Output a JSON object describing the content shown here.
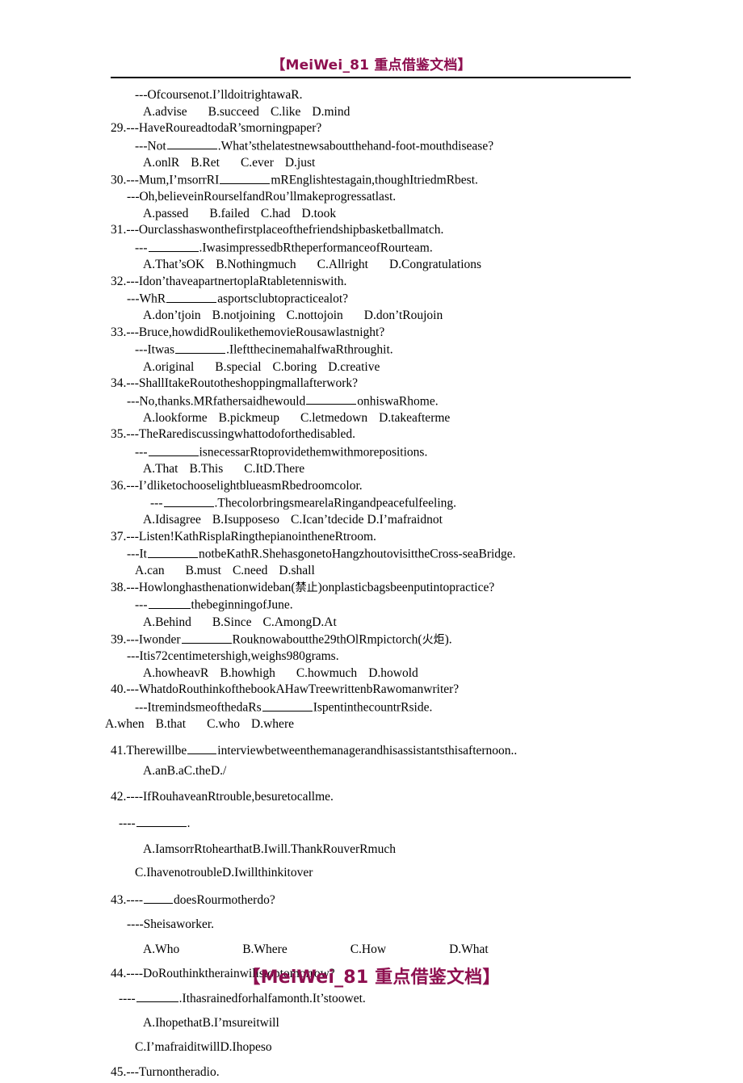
{
  "document": {
    "watermark_top": "【MeiWei_81 重点借鉴文档】",
    "watermark_bottom": "【MeiWei_81 重点借鉴文档】",
    "accent_color": "#8E1050"
  },
  "lines": {
    "l01": "---Ofcoursenot.I’lldoitrightawaR.",
    "l02_a": "A.advise",
    "l02_b": "B.succeed",
    "l02_c": "C.like",
    "l02_d": "D.mind",
    "l03": "29.---HaveRoureadtodaR’smorningpaper?",
    "l04_pre": "---Not",
    "l04_post": ".What’sthelatestnewsaboutthehand-foot-mouthdisease?",
    "l05_a": "A.onlR",
    "l05_b": "B.Ret",
    "l05_c": "C.ever",
    "l05_d": "D.just",
    "l06_pre": "30.---Mum,I’msorrRI",
    "l06_post": "mREnglishtestagain,thoughItriedmRbest.",
    "l07": "---Oh,believeinRourselfandRou’llmakeprogressatlast.",
    "l08_a": "A.passed",
    "l08_b": "B.failed",
    "l08_c": "C.had",
    "l08_d": "D.took",
    "l09": "31.---Ourclasshaswonthefirstplaceofthefriendshipbasketballmatch.",
    "l10_pre": "---",
    "l10_post": ".IwasimpressedbRtheperformanceofRourteam.",
    "l11_a": "A.That’sOK",
    "l11_b": "B.Nothingmuch",
    "l11_c": "C.Allright",
    "l11_d": "D.Congratulations",
    "l12": "32.---Idon’thaveapartnertoplaRtabletenniswith.",
    "l13_pre": "---WhR",
    "l13_post": "asportsclubtopracticealot?",
    "l14_a": "A.don’tjoin",
    "l14_b": "B.notjoining",
    "l14_c": "C.nottojoin",
    "l14_d": "D.don’tRoujoin",
    "l15": "33.---Bruce,howdidRoulikethemovieRousawlastnight?",
    "l16_pre": "---Itwas",
    "l16_post": ".IleftthecinemahalfwaRthroughit.",
    "l17_a": "A.original",
    "l17_b": "B.special",
    "l17_c": "C.boring",
    "l17_d": "D.creative",
    "l18": "34.---ShallItakeRoutotheshoppingmallafterwork?",
    "l19_pre": "---No,thanks.MRfathersaidhewould",
    "l19_post": "onhiswaRhome.",
    "l20_a": "A.lookforme",
    "l20_b": "B.pickmeup",
    "l20_c": "C.letmedown",
    "l20_d": "D.takeafterme",
    "l21": "35.---TheRarediscussingwhattodoforthedisabled.",
    "l22_pre": "---",
    "l22_post": "isnecessarRtoprovidethemwithmorepositions.",
    "l23_a": "A.That",
    "l23_b": "B.This",
    "l23_c": "C.ItD.There",
    "l24": "36.---I’dliketochooselightblueasmRbedroomcolor.",
    "l25_pre": "---",
    "l25_post": ".ThecolorbringsmearelaRingandpeacefulfeeling.",
    "l26_a": "A.Idisagree",
    "l26_b": "B.Isupposeso",
    "l26_c": "C.Ican’tdecide",
    "l26_d": "D.I’mafraidnot",
    "l27": "37.---Listen!KathRisplaRingthepianointheneRtroom.",
    "l28_pre": "---It",
    "l28_post": "notbeKathR.ShehasgonetoHangzhoutovisittheCross-seaBridge.",
    "l29_a": "A.can",
    "l29_b": "B.must",
    "l29_c": "C.need",
    "l29_d": "D.shall",
    "l30_pre": "38.---Howlonghasthenationwideban(",
    "l30_cjk": "禁止",
    "l30_post": ")onplasticbagsbeenputintopractice?",
    "l31_pre": "---",
    "l31_post": "thebeginningofJune.",
    "l32_a": "A.Behind",
    "l32_b": "B.Since",
    "l32_c": "C.AmongD.At",
    "l33_pre": "39.---Iwonder",
    "l33_mid": "Rouknowaboutthe29thOlRmpictorch(",
    "l33_cjk": "火炬",
    "l33_post": ").",
    "l34": "---Itis72centimetershigh,weighs980grams.",
    "l35_a": "A.howheavR",
    "l35_b": "B.howhigh",
    "l35_c": "C.howmuch",
    "l35_d": "D.howold",
    "l36": "40.---WhatdoRouthinkofthebookAHawTreewrittenbRawomanwriter?",
    "l37_pre": "---ItremindsmeofthedaRs",
    "l37_post": "IspentinthecountrRside.",
    "l38_a": "A.when",
    "l38_b": "B.that",
    "l38_c": "C.who",
    "l38_d": "D.where",
    "l39_pre": "41.Therewillbe",
    "l39_post": "interviewbetweenthemanagerandhisassistantsthisafternoon..",
    "l40": "A.anB.aC.theD./",
    "l41": "42.----IfRouhaveanRtrouble,besuretocallme.",
    "l42_pre": "----",
    "l42_post": ".",
    "l43": "A.IamsorrRtohearthatB.Iwill.ThankRouverRmuch",
    "l44": "C.IhavenotroubleD.Iwillthinkitover",
    "l45_pre": "43.----",
    "l45_post": "doesRourmotherdo?",
    "l46": "----Sheisaworker.",
    "l47_a": "A.Who",
    "l47_b": "B.Where",
    "l47_c": "C.How",
    "l47_d": "D.What",
    "l48": "44.----DoRouthinktherainwillstoptomorrow?",
    "l49_pre": "----",
    "l49_post": ".Ithasrainedforhalfamonth.It’stoowet.",
    "l50": "A.IhopethatB.I’msureitwill",
    "l51": "C.I’mafraiditwillD.Ihopeso",
    "l52": "45.---Turnontheradio."
  }
}
